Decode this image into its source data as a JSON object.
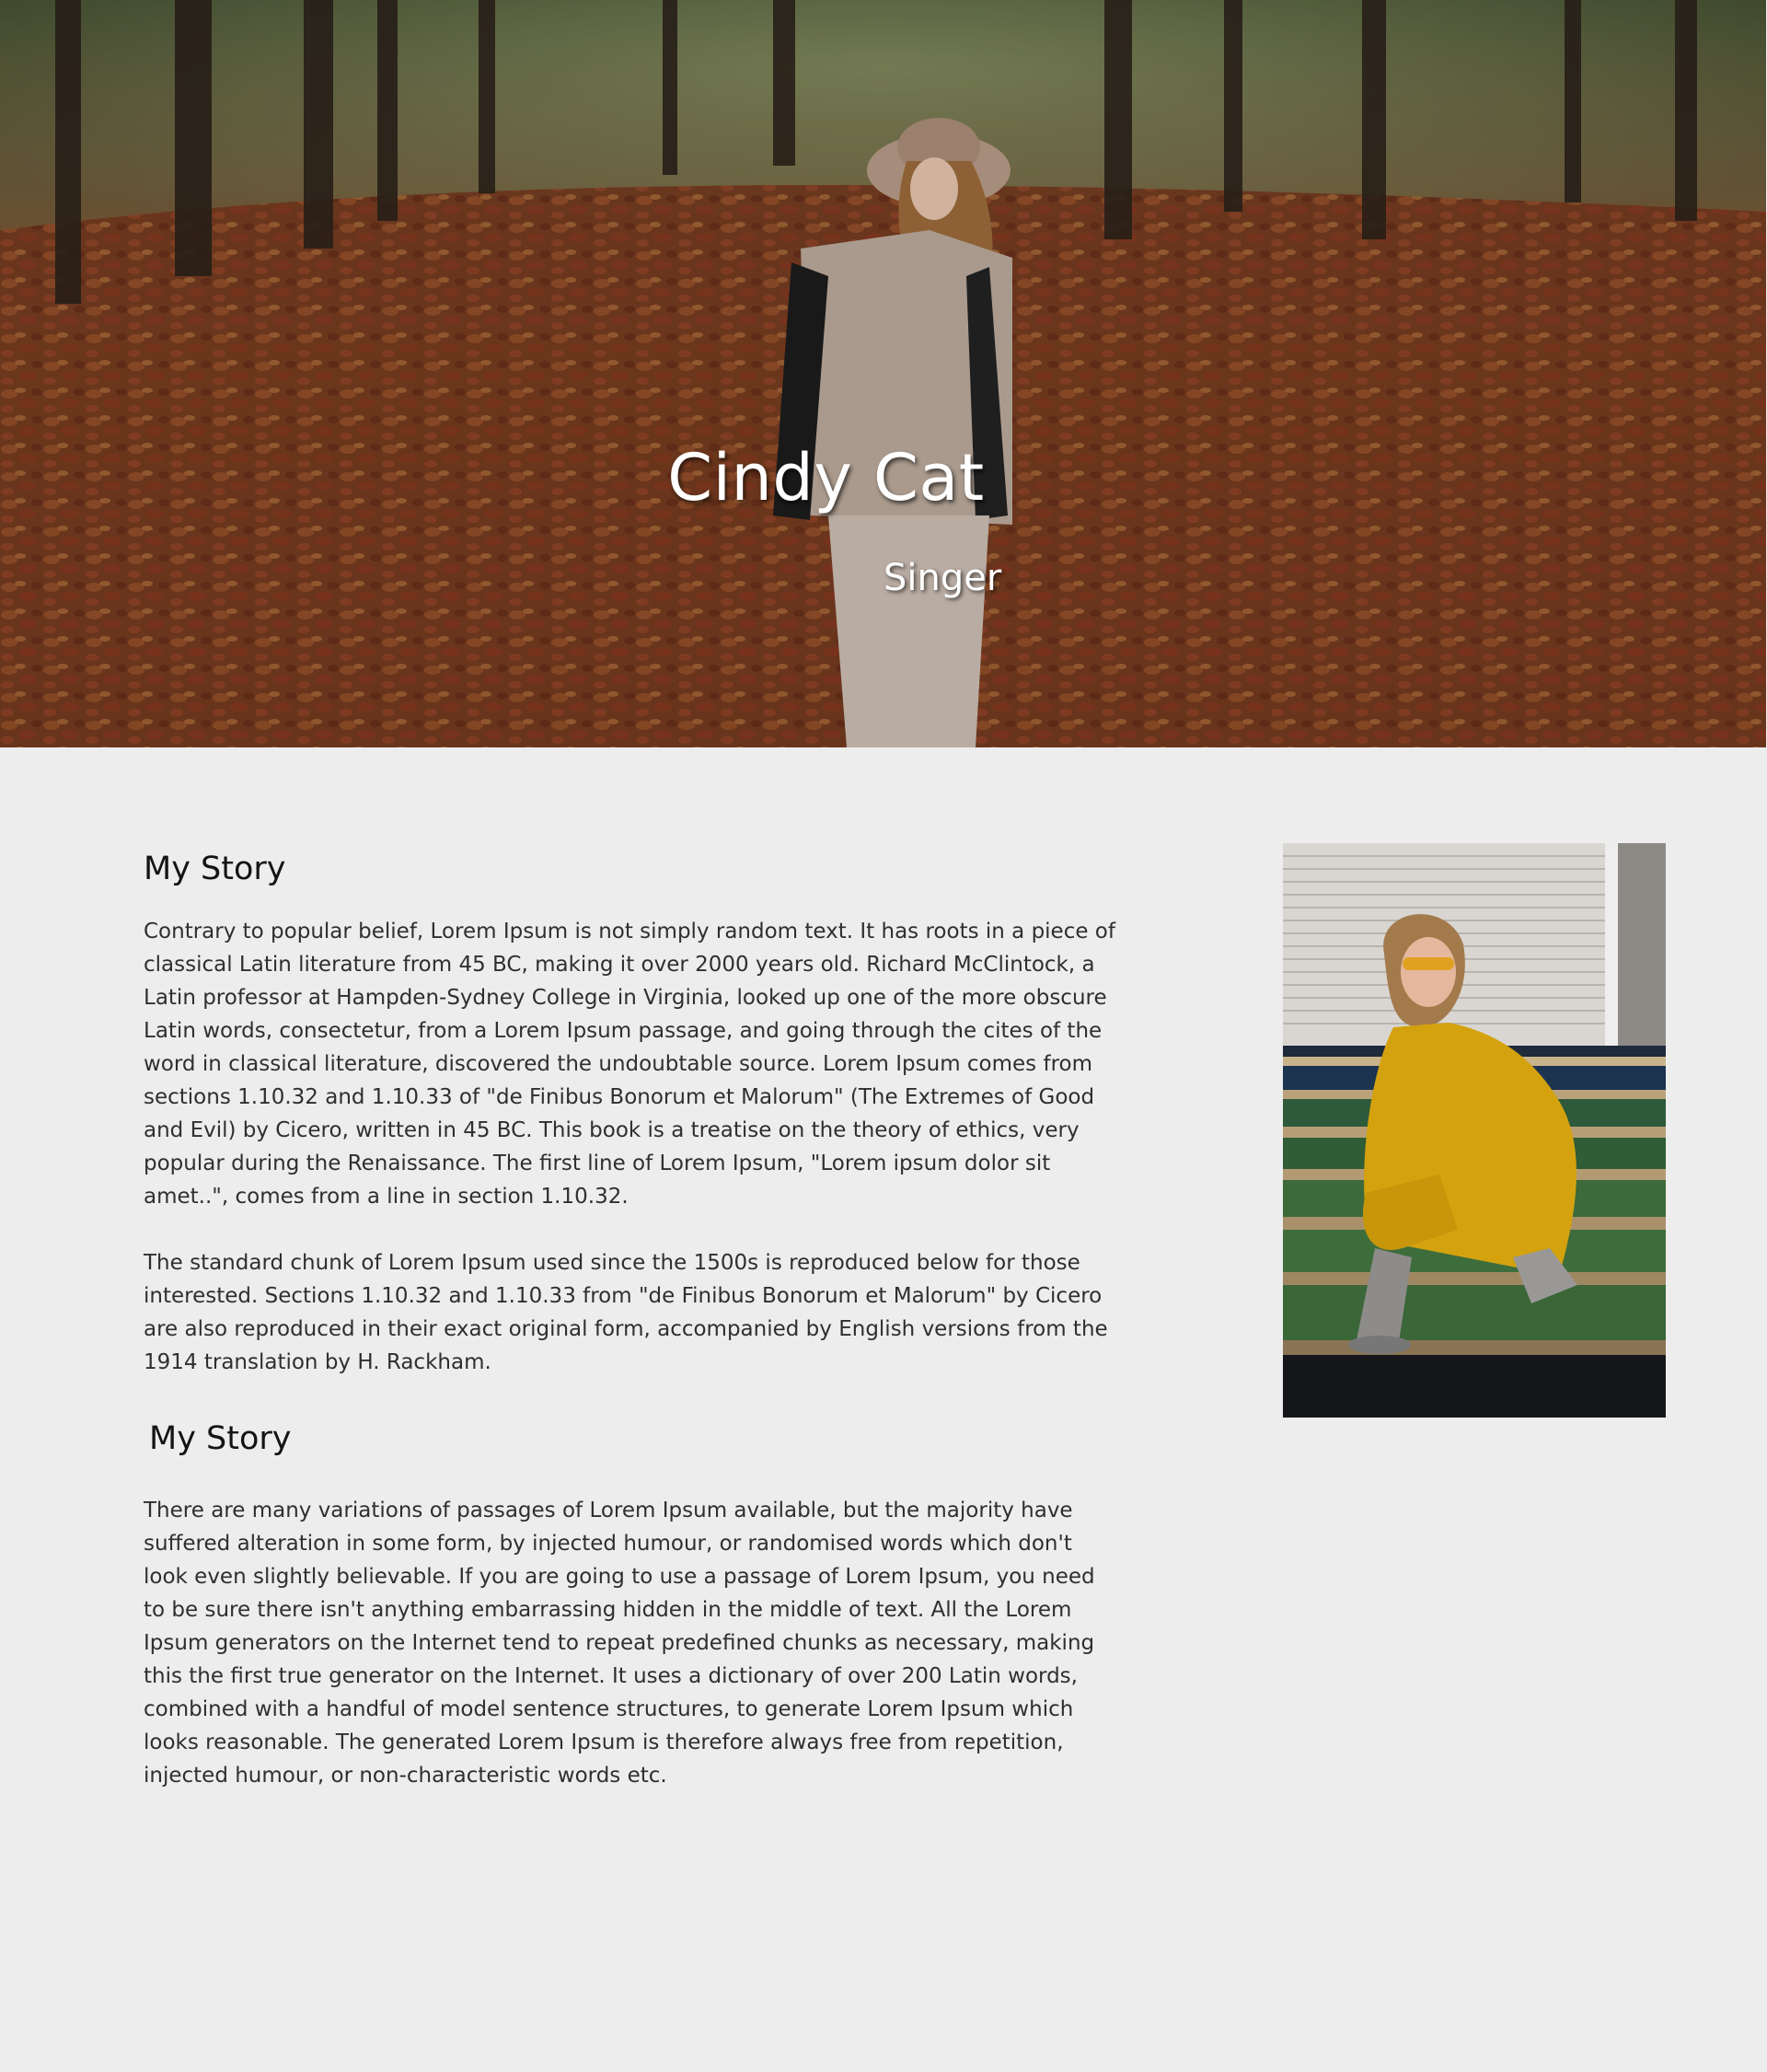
{
  "hero": {
    "title": "Cindy Cat",
    "subtitle": "Singer",
    "image_alt": "Woman in hat and grey coat standing among autumn leaves in a forest"
  },
  "story": {
    "heading_1": "My Story",
    "paragraph_1": "Contrary to popular belief, Lorem Ipsum is not simply random text. It has roots in a piece of classical Latin literature from 45 BC, making it over 2000 years old. Richard McClintock, a Latin professor at Hampden-Sydney College in Virginia, looked up one of the more obscure Latin words, consectetur, from a Lorem Ipsum passage, and going through the cites of the word in classical literature, discovered the undoubtable source. Lorem Ipsum comes from sections 1.10.32 and 1.10.33 of \"de Finibus Bonorum et Malorum\" (The Extremes of Good and Evil) by Cicero, written in 45 BC. This book is a treatise on the theory of ethics, very popular during the Renaissance. The first line of Lorem Ipsum, \"Lorem ipsum dolor sit amet..\", comes from a line in section 1.10.32.",
    "paragraph_2": "The standard chunk of Lorem Ipsum used since the 1500s is reproduced below for those interested. Sections 1.10.32 and 1.10.33 from \"de Finibus Bonorum et Malorum\" by Cicero are also reproduced in their exact original form, accompanied by English versions from the 1914 translation by H. Rackham.",
    "heading_2": "My Story",
    "paragraph_3": "There are many variations of passages of Lorem Ipsum available, but the majority have suffered alteration in some form, by injected humour, or randomised words which don't look even slightly believable. If you are going to use a passage of Lorem Ipsum, you need to be sure there isn't anything embarrassing hidden in the middle of text. All the Lorem Ipsum generators on the Internet tend to repeat predefined chunks as necessary, making this the first true generator on the Internet. It uses a dictionary of over 200 Latin words, combined with a handful of model sentence structures, to generate Lorem Ipsum which looks reasonable. The generated Lorem Ipsum is therefore always free from repetition, injected humour, or non-characteristic words etc."
  },
  "side_photo": {
    "image_alt": "Woman in yellow knit dress and sunglasses sitting on green steps"
  },
  "colors": {
    "page_background": "#ededed",
    "hero_text": "#ffffff",
    "heading_text": "#141414",
    "body_text": "#2f2f2f"
  }
}
